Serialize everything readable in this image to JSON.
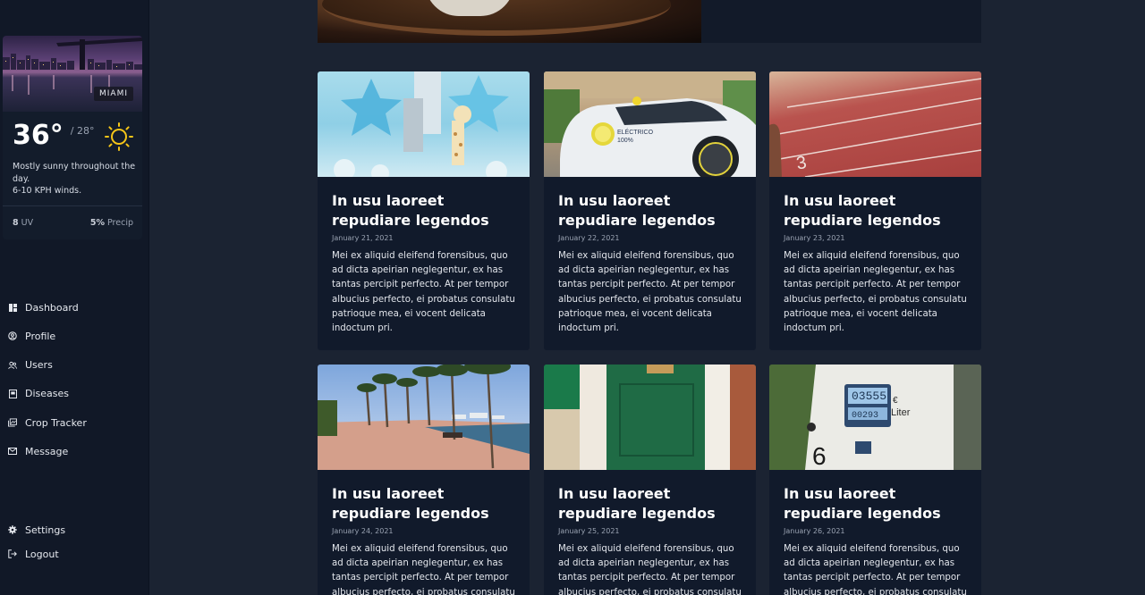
{
  "weather": {
    "city": "MIAMI",
    "temp": "36°",
    "temp_low": "/ 28°",
    "description_line1": "Mostly sunny throughout the day.",
    "description_line2": "6-10 KPH winds.",
    "uv_value": "8",
    "uv_label": "UV",
    "precip_value": "5%",
    "precip_label": "Precip",
    "icon": "sun-icon"
  },
  "nav": {
    "items": [
      {
        "label": "Dashboard",
        "icon": "dashboard-icon"
      },
      {
        "label": "Profile",
        "icon": "profile-icon"
      },
      {
        "label": "Users",
        "icon": "users-icon"
      },
      {
        "label": "Diseases",
        "icon": "diseases-icon"
      },
      {
        "label": "Crop Tracker",
        "icon": "crop-tracker-icon"
      },
      {
        "label": "Message",
        "icon": "message-icon"
      }
    ],
    "bottom": [
      {
        "label": "Settings",
        "icon": "gear-icon"
      },
      {
        "label": "Logout",
        "icon": "logout-icon"
      }
    ]
  },
  "posts": [
    {
      "title": "In usu laoreet repudiare legendos",
      "date": "January 21, 2021",
      "body": "Mei ex aliquid eleifend forensibus, quo ad dicta apeirian neglegentur, ex has tantas percipit perfecto. At per tempor albucius perfecto, ei probatus consulatu patrioque mea, ei vocent delicata indoctum pri.",
      "image": "balloons-photo"
    },
    {
      "title": "In usu laoreet repudiare legendos",
      "date": "January 22, 2021",
      "body": "Mei ex aliquid eleifend forensibus, quo ad dicta apeirian neglegentur, ex has tantas percipit perfecto. At per tempor albucius perfecto, ei probatus consulatu patrioque mea, ei vocent delicata indoctum pri.",
      "image": "electric-car-photo"
    },
    {
      "title": "In usu laoreet repudiare legendos",
      "date": "January 23, 2021",
      "body": "Mei ex aliquid eleifend forensibus, quo ad dicta apeirian neglegentur, ex has tantas percipit perfecto. At per tempor albucius perfecto, ei probatus consulatu patrioque mea, ei vocent delicata indoctum pri.",
      "image": "running-track-photo"
    },
    {
      "title": "In usu laoreet repudiare legendos",
      "date": "January 24, 2021",
      "body": "Mei ex aliquid eleifend forensibus, quo ad dicta apeirian neglegentur, ex has tantas percipit perfecto. At per tempor albucius perfecto, ei probatus consulatu",
      "image": "palm-promenade-photo"
    },
    {
      "title": "In usu laoreet repudiare legendos",
      "date": "January 25, 2021",
      "body": "Mei ex aliquid eleifend forensibus, quo ad dicta apeirian neglegentur, ex has tantas percipit perfecto. At per tempor albucius perfecto, ei probatus consulatu",
      "image": "green-door-photo"
    },
    {
      "title": "In usu laoreet repudiare legendos",
      "date": "January 26, 2021",
      "body": "Mei ex aliquid eleifend forensibus, quo ad dicta apeirian neglegentur, ex has tantas percipit perfecto. At per tempor albucius perfecto, ei probatus consulatu",
      "image": "fuel-pump-photo"
    }
  ]
}
